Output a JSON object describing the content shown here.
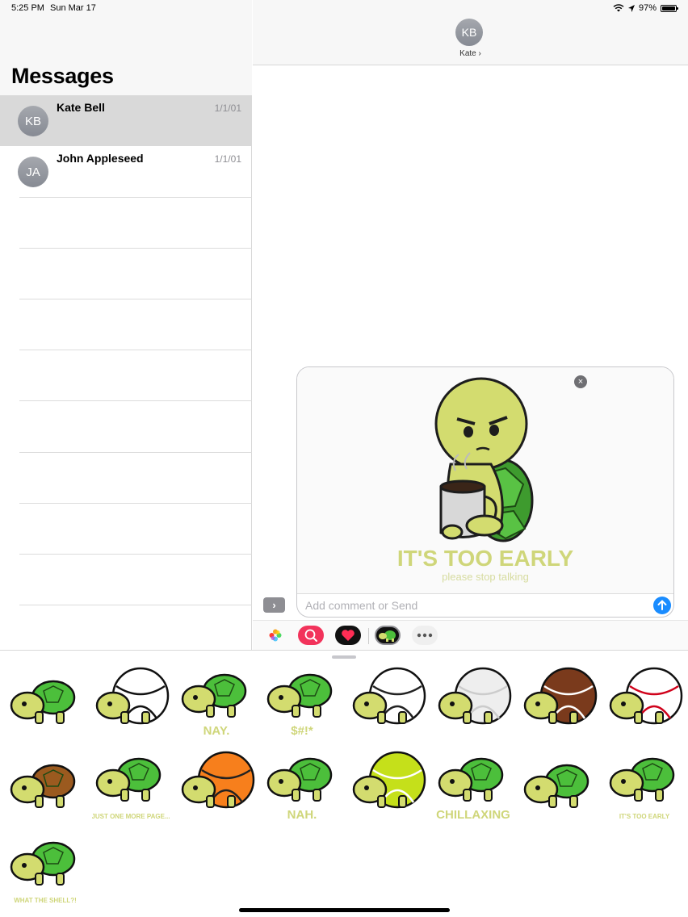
{
  "status": {
    "time": "5:25 PM",
    "date": "Sun Mar 17",
    "battery": "97%",
    "battery_level": 0.97
  },
  "sidebar": {
    "title": "Messages",
    "conversations": [
      {
        "initials": "KB",
        "name": "Kate Bell",
        "date": "1/1/01",
        "selected": true
      },
      {
        "initials": "JA",
        "name": "John Appleseed",
        "date": "1/1/01",
        "selected": false
      }
    ]
  },
  "conversation": {
    "initials": "KB",
    "contact": "Kate ›"
  },
  "compose": {
    "placeholder": "Add comment or Send",
    "sticker_caption": "IT'S TOO EARLY",
    "sticker_subcaption": "please stop talking"
  },
  "stickers": [
    {
      "name": "turtle-plain"
    },
    {
      "name": "turtle-soccer"
    },
    {
      "name": "turtle-nay",
      "text": "NAY."
    },
    {
      "name": "turtle-swear",
      "text": "$#!*"
    },
    {
      "name": "turtle-volleyball"
    },
    {
      "name": "turtle-golf"
    },
    {
      "name": "turtle-football"
    },
    {
      "name": "turtle-baseball"
    },
    {
      "name": "turtle-brown"
    },
    {
      "name": "turtle-reading",
      "text": "JUST ONE MORE PAGE..."
    },
    {
      "name": "turtle-basketball"
    },
    {
      "name": "turtle-nah",
      "text": "NAH."
    },
    {
      "name": "turtle-tennis"
    },
    {
      "name": "turtle-chillaxing",
      "text": "CHILLAXING"
    },
    {
      "name": "turtle-sleepy"
    },
    {
      "name": "turtle-too-early",
      "text": "IT'S TOO EARLY"
    },
    {
      "name": "turtle-what-the-shell",
      "text": "WHAT THE SHELL?!"
    }
  ],
  "colors": {
    "accent": "#1a8cff",
    "turtle_skin": "#d3dc6f",
    "shell_green": "#4cbf3b",
    "caption": "#cfd67a"
  }
}
